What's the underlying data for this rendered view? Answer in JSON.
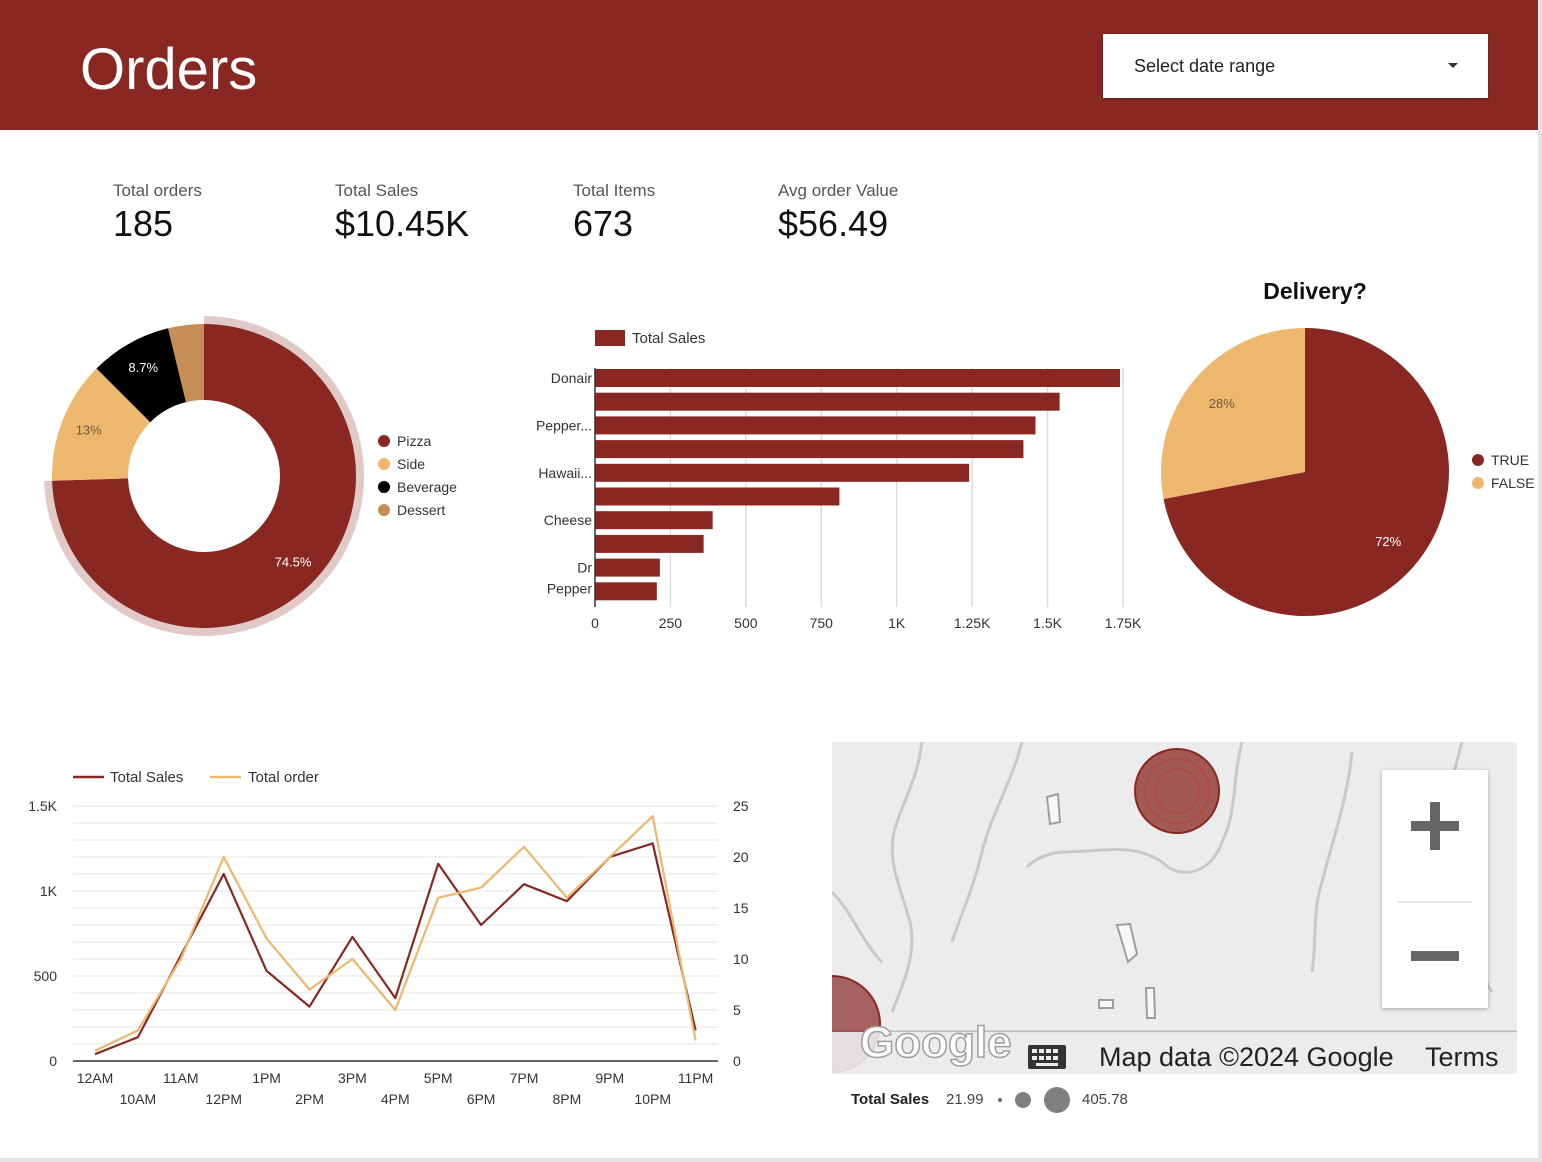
{
  "header": {
    "title": "Orders",
    "date_range": {
      "label": "Select date range",
      "icon": "dropdown-arrow-icon"
    }
  },
  "kpis": [
    {
      "label": "Total orders",
      "value": "185"
    },
    {
      "label": "Total Sales",
      "value": "$10.45K"
    },
    {
      "label": "Total Items",
      "value": "673"
    },
    {
      "label": "Avg order Value",
      "value": "$56.49"
    }
  ],
  "colors": {
    "brand": "#892822",
    "side": "#EDB76D",
    "beverage": "#000000",
    "dessert": "#C68E54",
    "grid": "#dddddd"
  },
  "chart_data": [
    {
      "type": "pie",
      "variant": "donut",
      "labels": [
        "Pizza",
        "Side",
        "Beverage",
        "Dessert"
      ],
      "values": [
        74.5,
        13,
        8.7,
        3.8
      ],
      "value_labels": [
        "74.5%",
        "13%",
        "8.7%",
        ""
      ],
      "colors": [
        "#892822",
        "#EDB76D",
        "#000000",
        "#C68E54"
      ],
      "legend": "right"
    },
    {
      "type": "bar",
      "orientation": "horizontal",
      "series": [
        {
          "name": "Total Sales",
          "color": "#892822",
          "values": [
            1740,
            1540,
            1460,
            1420,
            1240,
            810,
            390,
            360,
            215,
            205
          ]
        }
      ],
      "category_labels": [
        {
          "index": 0,
          "text": [
            "Donair"
          ]
        },
        {
          "index": 2,
          "text": [
            "Pepper..."
          ]
        },
        {
          "index": 4,
          "text": [
            "Hawaii..."
          ]
        },
        {
          "index": 6,
          "text": [
            "Cheese"
          ]
        },
        {
          "index": 8,
          "text": [
            "Dr",
            "Pepper"
          ]
        }
      ],
      "x_ticks": [
        0,
        250,
        500,
        750,
        1000,
        1250,
        1500,
        1750
      ],
      "x_tick_labels": [
        "0",
        "250",
        "500",
        "750",
        "1K",
        "1.25K",
        "1.5K",
        "1.75K"
      ],
      "xlim": [
        0,
        1750
      ],
      "legend": "top"
    },
    {
      "type": "pie",
      "title": "Delivery?",
      "labels": [
        "TRUE",
        "FALSE"
      ],
      "values": [
        72,
        28
      ],
      "value_labels": [
        "72%",
        "28%"
      ],
      "colors": [
        "#892822",
        "#EDB76D"
      ],
      "legend": "right"
    },
    {
      "type": "line",
      "categories": [
        "12AM",
        "10AM",
        "11AM",
        "12PM",
        "1PM",
        "2PM",
        "3PM",
        "4PM",
        "5PM",
        "6PM",
        "7PM",
        "8PM",
        "9PM",
        "10PM",
        "11PM"
      ],
      "series": [
        {
          "name": "Total Sales",
          "axis": "left",
          "color": "#892822",
          "values": [
            40,
            140,
            620,
            1100,
            530,
            320,
            730,
            370,
            1160,
            800,
            1040,
            940,
            1200,
            1280,
            180
          ]
        },
        {
          "name": "Total order",
          "axis": "right",
          "color": "#EDB76D",
          "values": [
            1,
            3,
            10,
            20,
            12,
            7,
            10,
            5,
            16,
            17,
            21,
            16,
            20,
            24,
            2
          ]
        }
      ],
      "y_left": {
        "range": [
          0,
          1500
        ],
        "ticks": [
          0,
          500,
          1000,
          1500
        ],
        "tick_labels": [
          "0",
          "500",
          "1K",
          "1.5K"
        ]
      },
      "y_right": {
        "range": [
          0,
          25
        ],
        "ticks": [
          0,
          5,
          10,
          15,
          20,
          25
        ],
        "tick_labels": [
          "0",
          "5",
          "10",
          "15",
          "20",
          "25"
        ]
      },
      "legend": "top-left"
    }
  ],
  "map": {
    "brand": "Google",
    "attribution": "Map data ©2024 Google",
    "terms": "Terms",
    "zoom_in": "+",
    "zoom_out": "−",
    "legend": {
      "label": "Total Sales",
      "min": "21.99",
      "max": "405.78"
    }
  }
}
